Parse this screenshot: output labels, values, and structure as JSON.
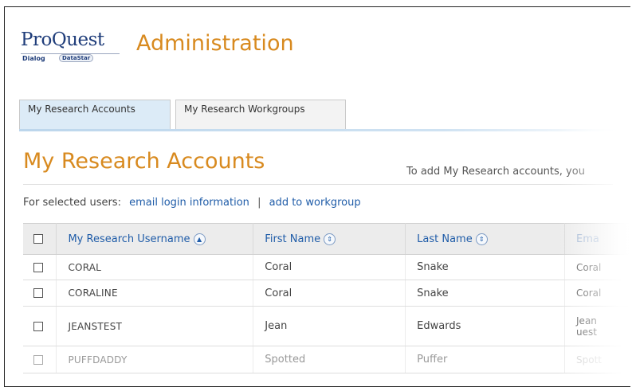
{
  "logo": {
    "brand": "ProQuest",
    "sub1": "Dialog",
    "sub2": "DataStar"
  },
  "app": {
    "title": "Administration"
  },
  "tabs": [
    {
      "label": "My Research Accounts",
      "active": true
    },
    {
      "label": "My Research Workgroups",
      "active": false
    }
  ],
  "page": {
    "title": "My Research Accounts",
    "hint": "To add My Research accounts, you"
  },
  "actions": {
    "prefix": "For selected users:",
    "email_login": "email login information",
    "separator": "|",
    "add_to_workgroup": "add to workgroup"
  },
  "table": {
    "headers": {
      "username": "My Research Username",
      "first": "First Name",
      "last": "Last Name",
      "email": "Ema"
    },
    "sort_icons": {
      "username": "▲",
      "first": "⇕",
      "last": "⇕"
    },
    "rows": [
      {
        "username": "CORAL",
        "first": "Coral",
        "last": "Snake",
        "email": "Coral"
      },
      {
        "username": "CORALINE",
        "first": "Coral",
        "last": "Snake",
        "email": "Coral"
      },
      {
        "username": "JEANSTEST",
        "first": "Jean",
        "last": "Edwards",
        "email": "Jean",
        "email2": "uest"
      },
      {
        "username": "PUFFDADDY",
        "first": "Spotted",
        "last": "Puffer",
        "email": "Spott"
      }
    ]
  },
  "colors": {
    "accent_orange": "#d88a1f",
    "link_blue": "#1f5ca8",
    "tab_active": "#dcebf7"
  }
}
